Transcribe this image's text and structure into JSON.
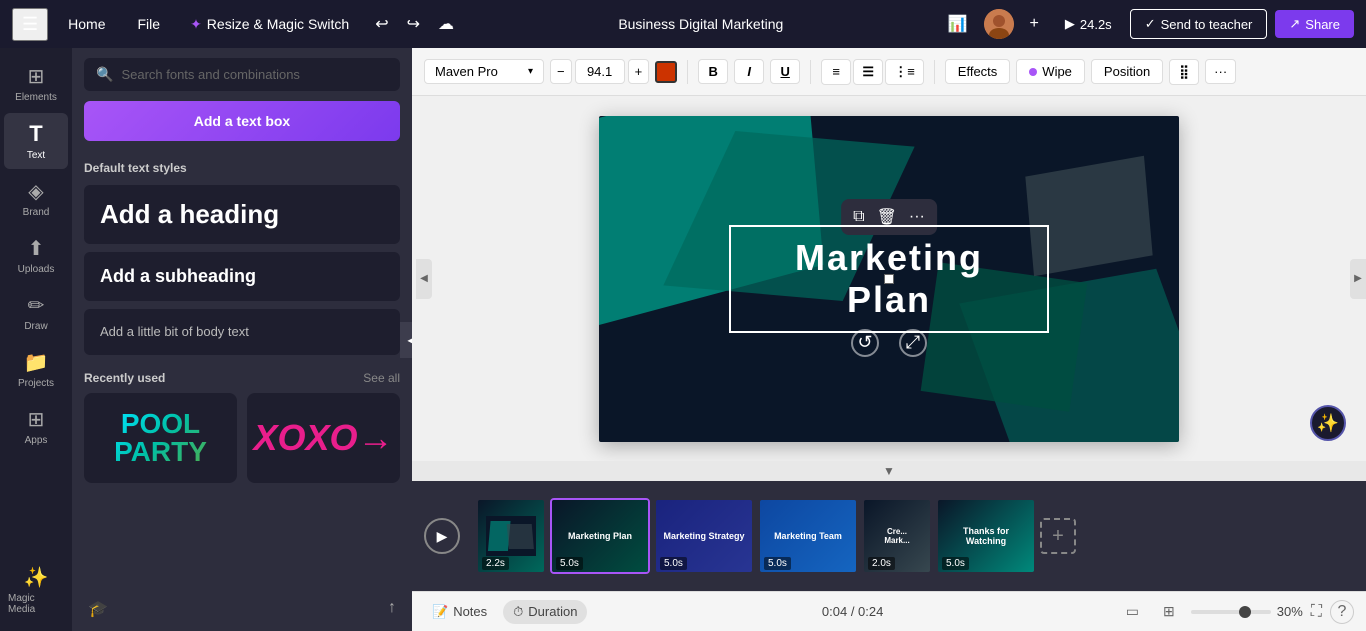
{
  "topbar": {
    "menu_icon": "☰",
    "home_label": "Home",
    "file_label": "File",
    "resize_label": "Resize & Magic Switch",
    "title": "Business Digital Marketing",
    "undo_icon": "↩",
    "redo_icon": "↪",
    "cloud_icon": "☁",
    "analytics_icon": "📊",
    "play_icon": "▶",
    "timer": "24.2s",
    "send_teacher_label": "Send to teacher",
    "share_label": "Share",
    "plus_icon": "+",
    "checkmark_icon": "✓"
  },
  "sidebar": {
    "items": [
      {
        "id": "elements",
        "icon": "⊞",
        "label": "Elements"
      },
      {
        "id": "text",
        "icon": "T",
        "label": "Text"
      },
      {
        "id": "brand",
        "icon": "🏷",
        "label": "Brand"
      },
      {
        "id": "uploads",
        "icon": "⬆",
        "label": "Uploads"
      },
      {
        "id": "draw",
        "icon": "✏",
        "label": "Draw"
      },
      {
        "id": "projects",
        "icon": "📁",
        "label": "Projects"
      },
      {
        "id": "apps",
        "icon": "⊞",
        "label": "Apps"
      },
      {
        "id": "magic-media",
        "icon": "✨",
        "label": "Magic Media"
      }
    ]
  },
  "left_panel": {
    "search_placeholder": "Search fonts and combinations",
    "add_textbox_label": "Add a text box",
    "default_styles_title": "Default text styles",
    "heading_label": "Add a heading",
    "subheading_label": "Add a subheading",
    "body_label": "Add a little bit of body text",
    "recently_used_title": "Recently used",
    "see_all_label": "See all",
    "font_thumbs": [
      {
        "id": "pool-party",
        "text": "POOL\nPARTY"
      },
      {
        "id": "xoxo",
        "text": "XOXO"
      }
    ]
  },
  "toolbar": {
    "font_name": "Maven Pro",
    "font_size": "94.1",
    "minus_icon": "−",
    "plus_icon": "+",
    "bold_label": "B",
    "italic_label": "I",
    "underline_label": "U",
    "effects_label": "Effects",
    "wipe_label": "Wipe",
    "position_label": "Position",
    "more_icon": "···",
    "color": "#cc3300"
  },
  "canvas": {
    "slide_text": "Marketing Plan",
    "selection_toolbar": {
      "copy_icon": "⧉",
      "delete_icon": "🗑",
      "more_icon": "···"
    },
    "expand_icon": "↻"
  },
  "timeline": {
    "play_icon": "▶",
    "slides": [
      {
        "id": 1,
        "duration": "2.2s",
        "label": "",
        "bg_class": "thumb-bg-1",
        "active": false
      },
      {
        "id": 2,
        "duration": "5.0s",
        "label": "Marketing Plan",
        "bg_class": "thumb-bg-2",
        "active": true
      },
      {
        "id": 3,
        "duration": "5.0s",
        "label": "Marketing Strategy",
        "bg_class": "thumb-bg-3",
        "active": false
      },
      {
        "id": 4,
        "duration": "5.0s",
        "label": "Marketing Team",
        "bg_class": "thumb-bg-4",
        "active": false
      },
      {
        "id": 5,
        "duration": "2.0s",
        "label": "Cre...\nMark...",
        "bg_class": "thumb-bg-5",
        "active": false
      },
      {
        "id": 6,
        "duration": "5.0s",
        "label": "Thanks for\nWatching",
        "bg_class": "thumb-bg-6",
        "active": false
      }
    ],
    "add_icon": "+"
  },
  "bottom_bar": {
    "notes_icon": "📝",
    "notes_label": "Notes",
    "duration_icon": "⏱",
    "duration_label": "Duration",
    "time_current": "0:04",
    "time_total": "0:24",
    "time_separator": "/",
    "zoom_level": "30%",
    "view_icon_grid": "⊞",
    "fullscreen_icon": "⛶",
    "help_icon": "?",
    "magic_icon": "✨"
  }
}
